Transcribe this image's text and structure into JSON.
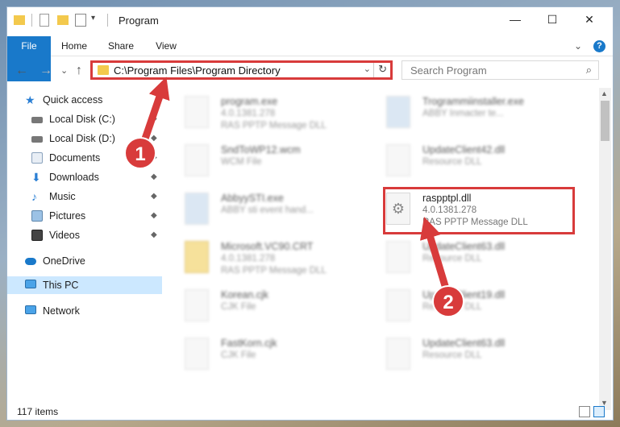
{
  "window": {
    "title": "Program",
    "minimize": "—",
    "maximize": "☐",
    "close": "✕"
  },
  "ribbon": {
    "tabs": [
      "File",
      "Home",
      "Share",
      "View"
    ],
    "collapse": "⌄",
    "help": "?"
  },
  "nav": {
    "back": "←",
    "forward": "→",
    "recent": "⌄",
    "up": "↑",
    "address_path": "C:\\Program Files\\Program Directory",
    "dropdown": "⌄",
    "refresh": "↻",
    "search_placeholder": "Search Program",
    "search_icon": "⌕"
  },
  "sidebar": {
    "items": [
      {
        "label": "Quick access",
        "icon": "star-icon",
        "pinned": false
      },
      {
        "label": "Local Disk (C:)",
        "icon": "drive-icon",
        "pinned": true
      },
      {
        "label": "Local Disk (D:)",
        "icon": "drive-icon",
        "pinned": true
      },
      {
        "label": "Documents",
        "icon": "documents-icon",
        "pinned": true
      },
      {
        "label": "Downloads",
        "icon": "download-icon",
        "pinned": true
      },
      {
        "label": "Music",
        "icon": "music-icon",
        "pinned": true
      },
      {
        "label": "Pictures",
        "icon": "pictures-icon",
        "pinned": true
      },
      {
        "label": "Videos",
        "icon": "videos-icon",
        "pinned": true
      },
      {
        "label": "OneDrive",
        "icon": "cloud-icon",
        "pinned": false
      },
      {
        "label": "This PC",
        "icon": "monitor-icon",
        "pinned": false
      },
      {
        "label": "Network",
        "icon": "network-icon",
        "pinned": false
      }
    ],
    "pin_glyph": "📌"
  },
  "files": [
    {
      "name": "program.exe",
      "line2": "4.0.1381.278",
      "line3": "RAS PPTP Message DLL",
      "blurred": true
    },
    {
      "name": "Trogrammiinstaller.exe",
      "line2": "ABBY Inmacter te...",
      "line3": "",
      "blurred": true
    },
    {
      "name": "SndToWP12.wcm",
      "line2": "WCM File",
      "line3": "",
      "blurred": true
    },
    {
      "name": "UpdateClient42.dll",
      "line2": "Resource DLL",
      "line3": "",
      "blurred": true
    },
    {
      "name": "AbbyySTI.exe",
      "line2": "ABBY sti event hand...",
      "line3": "",
      "blurred": true
    },
    {
      "name": "raspptpl.dll",
      "line2": "4.0.1381.278",
      "line3": "RAS PPTP Message DLL",
      "blurred": false
    },
    {
      "name": "Microsoft.VC90.CRT",
      "line2": "4.0.1381.278",
      "line3": "RAS PPTP Message DLL",
      "blurred": true
    },
    {
      "name": "UpdateClient63.dll",
      "line2": "Resource DLL",
      "line3": "",
      "blurred": true
    },
    {
      "name": "Korean.cjk",
      "line2": "CJK File",
      "line3": "",
      "blurred": true
    },
    {
      "name": "UpdateClient19.dll",
      "line2": "Resource DLL",
      "line3": "",
      "blurred": true
    },
    {
      "name": "FastKorn.cjk",
      "line2": "CJK File",
      "line3": "",
      "blurred": true
    },
    {
      "name": "UpdateClient63.dll",
      "line2": "Resource DLL",
      "line3": "",
      "blurred": true
    }
  ],
  "status": {
    "items_count": "117 items"
  },
  "annotations": [
    {
      "number": "1"
    },
    {
      "number": "2"
    }
  ],
  "colors": {
    "accent": "#1979ca",
    "highlight": "#d83b3b",
    "selected": "#cce8ff"
  }
}
